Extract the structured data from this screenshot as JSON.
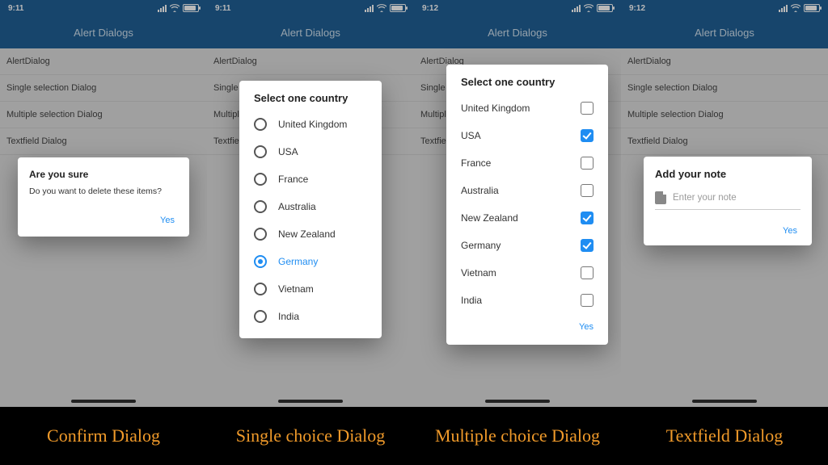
{
  "status": {
    "time_a": "9:11",
    "time_b": "9:12"
  },
  "app": {
    "title": "Alert Dialogs"
  },
  "list": {
    "item1": "AlertDialog",
    "item2": "Single selection Dialog",
    "item3": "Multiple selection Dialog",
    "item4": "Textfield Dialog",
    "multiTrunc": "Multipl",
    "singleTrunc": "Single"
  },
  "confirm": {
    "title": "Are you sure",
    "message": "Do you want to delete these items?",
    "action": "Yes"
  },
  "single": {
    "title": "Select one country",
    "opt1": "United Kingdom",
    "opt2": "USA",
    "opt3": "France",
    "opt4": "Australia",
    "opt5": "New Zealand",
    "opt6": "Germany",
    "opt7": "Vietnam",
    "opt8": "India",
    "selected": "Germany"
  },
  "multi": {
    "title": "Select one country",
    "opt1": "United Kingdom",
    "opt2": "USA",
    "opt3": "France",
    "opt4": "Australia",
    "opt5": "New Zealand",
    "opt6": "Germany",
    "opt7": "Vietnam",
    "opt8": "India",
    "action": "Yes"
  },
  "textfield": {
    "title": "Add your note",
    "placeholder": "Enter your note",
    "action": "Yes"
  },
  "captions": {
    "c1": "Confirm Dialog",
    "c2": "Single choice Dialog",
    "c3": "Multiple choice Dialog",
    "c4": "Textfield Dialog"
  }
}
